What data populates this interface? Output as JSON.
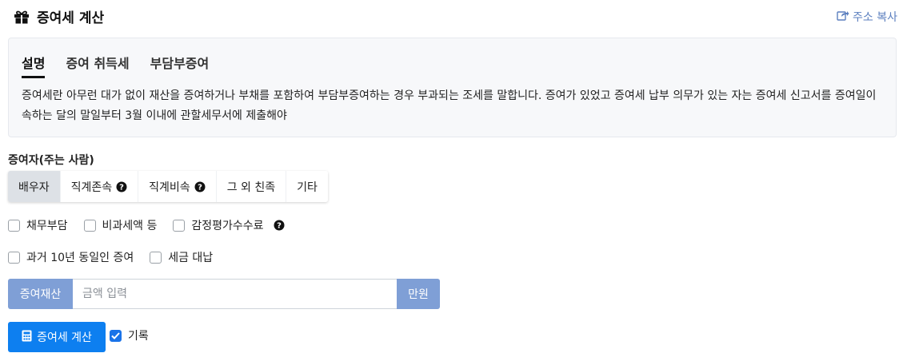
{
  "header": {
    "title": "증여세 계산",
    "title_icon": "gift-icon",
    "copy_link_label": "주소 복사",
    "copy_link_icon": "share-icon"
  },
  "info": {
    "tabs": [
      {
        "label": "설명",
        "active": true
      },
      {
        "label": "증여 취득세",
        "active": false
      },
      {
        "label": "부담부증여",
        "active": false
      }
    ],
    "description": "증여세란 아무런 대가 없이 재산을 증여하거나 부채를 포함하여 부담부증여하는 경우 부과되는 조세를 말합니다. 증여가 있었고 증여세 납부 의무가 있는 자는 증여세 신고서를 증여일이 속하는 달의 말일부터 3월 이내에 관할세무서에 제출해야"
  },
  "donor": {
    "label": "증여자(주는 사람)",
    "options": [
      {
        "label": "배우자",
        "selected": true,
        "help": false
      },
      {
        "label": "직계존속",
        "selected": false,
        "help": true
      },
      {
        "label": "직계비속",
        "selected": false,
        "help": true
      },
      {
        "label": "그 외 친족",
        "selected": false,
        "help": false
      },
      {
        "label": "기타",
        "selected": false,
        "help": false
      }
    ]
  },
  "options_row1": [
    {
      "label": "채무부담",
      "checked": false
    },
    {
      "label": "비과세액 등",
      "checked": false
    },
    {
      "label": "감정평가수수료",
      "checked": false,
      "help": true
    }
  ],
  "options_row2": [
    {
      "label": "과거 10년 동일인 증여",
      "checked": false
    },
    {
      "label": "세금 대납",
      "checked": false
    }
  ],
  "asset": {
    "prefix": "증여재산",
    "placeholder": "금액 입력",
    "value": "",
    "suffix": "만원"
  },
  "actions": {
    "calculate_label": "증여세 계산",
    "calculate_icon": "calculator-icon",
    "record_label": "기록",
    "record_checked": true
  },
  "colors": {
    "primary": "#0d7ff0",
    "addon": "#7f9fd6",
    "link": "#5b7fbf",
    "selected_segment": "#dde1e6"
  }
}
